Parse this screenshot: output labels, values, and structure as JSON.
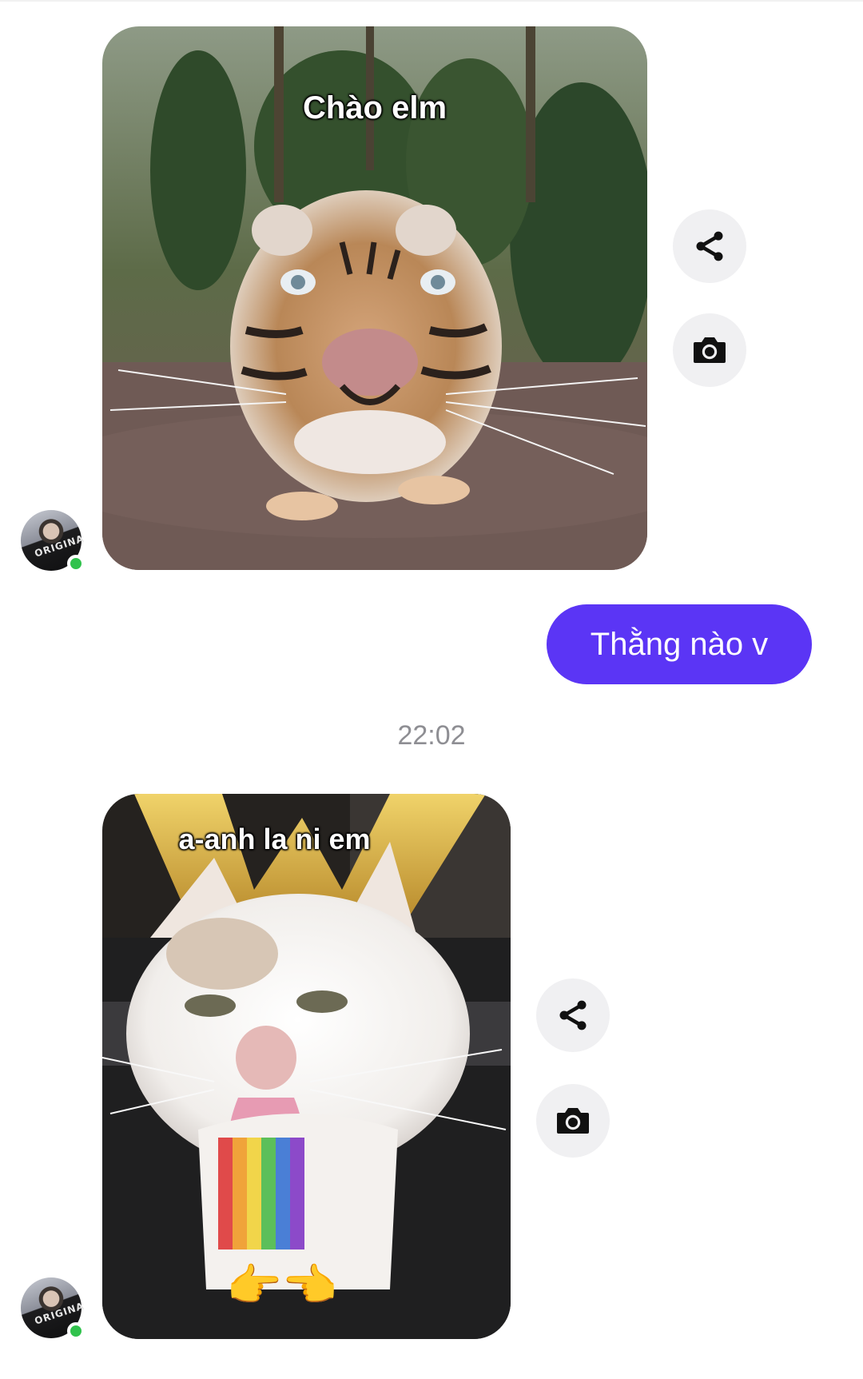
{
  "thread": {
    "messages": [
      {
        "type": "image",
        "direction": "incoming",
        "caption": "Chào elm",
        "subject": "tiger"
      },
      {
        "type": "text",
        "direction": "outgoing",
        "text": "Thằng nào v"
      },
      {
        "type": "image",
        "direction": "incoming",
        "caption": "a-anh la ni em",
        "subject": "cat",
        "emoji": "👉👈"
      }
    ],
    "timestamp": "22:02"
  },
  "avatar": {
    "shirt_text": "ORIGINA",
    "online": true
  },
  "icons": {
    "share": "share-icon",
    "camera": "camera-icon"
  },
  "colors": {
    "outgoing_bubble": "#5b35f5",
    "online_dot": "#31c24d",
    "action_button_bg": "#f0f0f2",
    "timestamp_text": "#8e8e93"
  }
}
